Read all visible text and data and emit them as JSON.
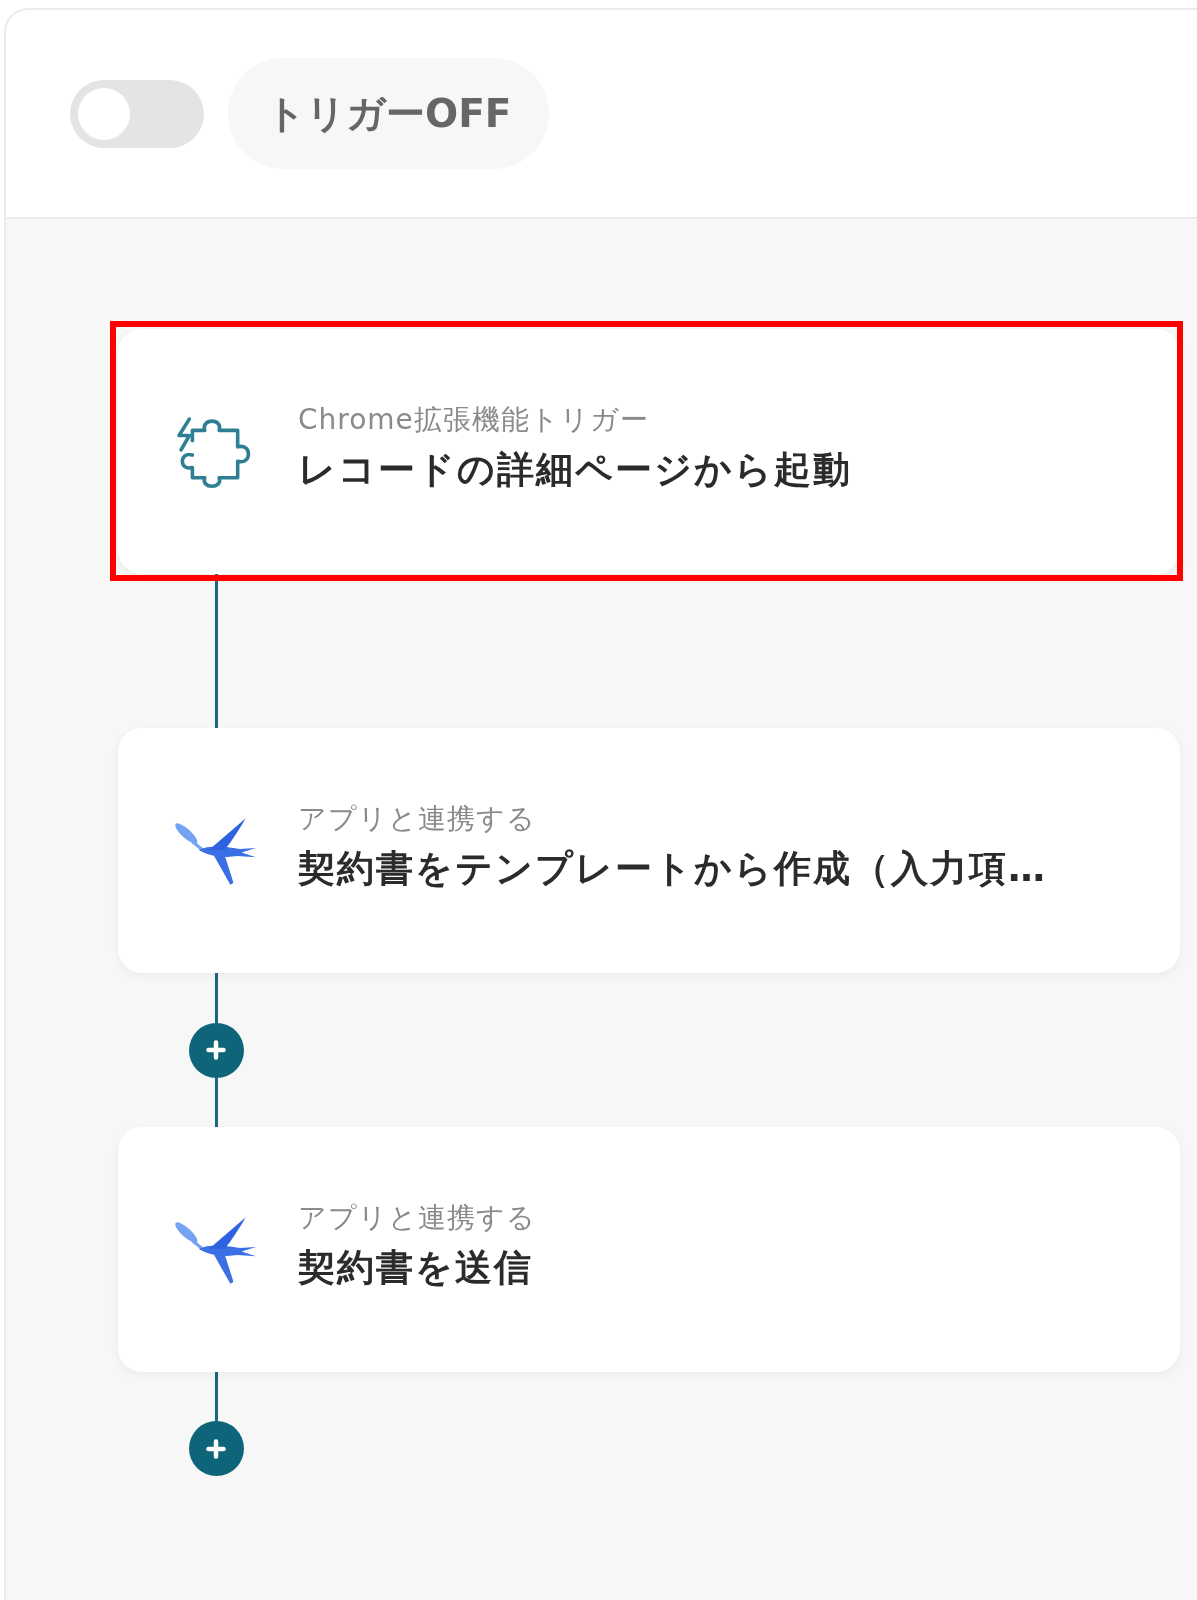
{
  "header": {
    "trigger_toggle": {
      "on": false
    },
    "trigger_status": "トリガーOFF"
  },
  "steps": [
    {
      "kind": "trigger",
      "category": "Chrome拡張機能トリガー",
      "title": "レコードの詳細ページから起動",
      "highlighted": true,
      "add_after": false
    },
    {
      "kind": "app",
      "category": "アプリと連携する",
      "title": "契約書をテンプレートから作成（入力項…",
      "highlighted": false,
      "add_after": true
    },
    {
      "kind": "app",
      "category": "アプリと連携する",
      "title": "契約書を送信",
      "highlighted": false,
      "add_after": true
    }
  ]
}
